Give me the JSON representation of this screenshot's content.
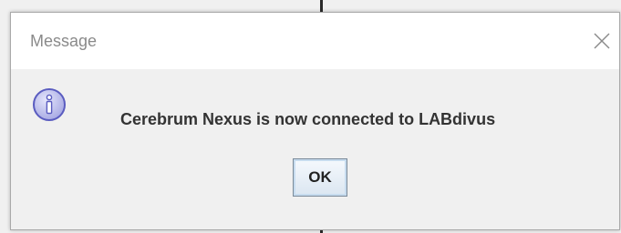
{
  "dialog": {
    "title": "Message",
    "message": "Cerebrum Nexus is now connected to LABdivus",
    "ok_label": "OK",
    "icon": "info-icon",
    "close_icon": "close-icon"
  },
  "colors": {
    "icon_fill": "#b7b9ea",
    "icon_stroke": "#5a5cc0",
    "button_border": "#7a8a99"
  }
}
